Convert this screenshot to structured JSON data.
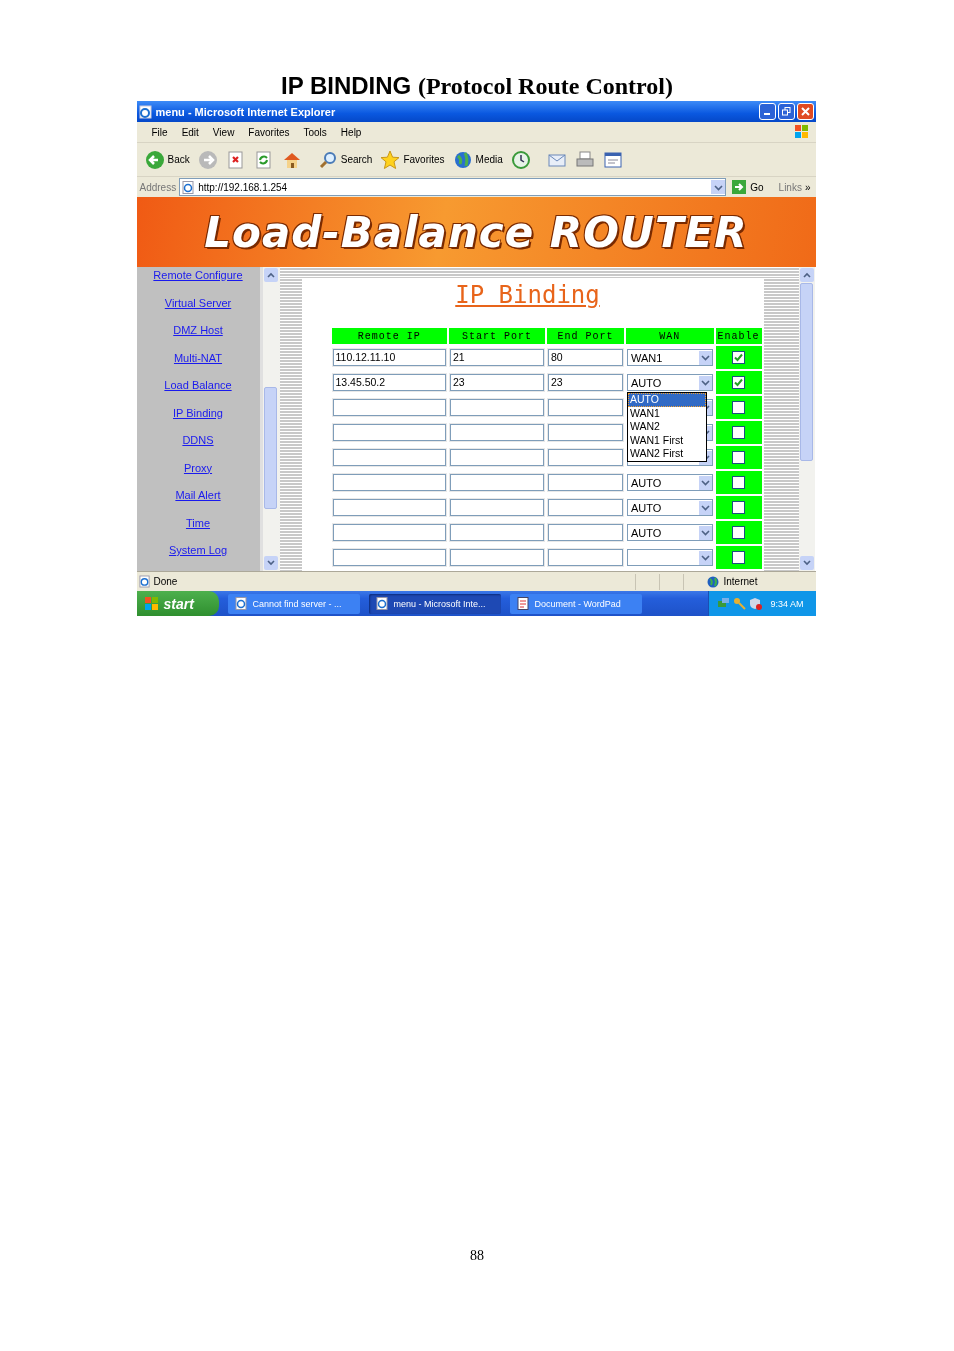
{
  "heading": {
    "title": "IP BINDING",
    "subtitle": "(Protocol Route Control)"
  },
  "window": {
    "title": "menu - Microsoft Internet Explorer"
  },
  "menu": [
    "File",
    "Edit",
    "View",
    "Favorites",
    "Tools",
    "Help"
  ],
  "toolbar": [
    {
      "kind": "back",
      "label": "Back"
    },
    {
      "kind": "forward"
    },
    {
      "kind": "stop"
    },
    {
      "kind": "refresh"
    },
    {
      "kind": "home"
    },
    {
      "kind": "search",
      "label": "Search"
    },
    {
      "kind": "favorites",
      "label": "Favorites"
    },
    {
      "kind": "media",
      "label": "Media"
    },
    {
      "kind": "history"
    },
    {
      "kind": "mail"
    },
    {
      "kind": "print"
    },
    {
      "kind": "edit"
    }
  ],
  "address": {
    "label": "Address",
    "value": "http://192.168.1.254",
    "go": "Go",
    "links": "Links",
    "more": "»"
  },
  "banner": {
    "title": "Load-Balance ROUTER"
  },
  "sidebar": {
    "items": [
      "Remote Configure",
      "Virtual Server",
      "DMZ Host",
      "Multi-NAT",
      "Load Balance",
      "IP Binding",
      "DDNS",
      "Proxy",
      "Mail Alert",
      "Time",
      "System Log"
    ]
  },
  "page": {
    "title": "IP Binding",
    "columns": [
      "Remote IP",
      "Start Port",
      "End Port",
      "WAN",
      "Enable"
    ],
    "rows": [
      {
        "remote_ip": "110.12.11.10",
        "start_port": "21",
        "end_port": "80",
        "wan": "WAN1",
        "enabled": true
      },
      {
        "remote_ip": "13.45.50.2",
        "start_port": "23",
        "end_port": "23",
        "wan": "AUTO",
        "enabled": true,
        "options": [
          {
            "label": "AUTO",
            "selected": true
          },
          {
            "label": "WAN1",
            "selected": false
          },
          {
            "label": "WAN2",
            "selected": false
          },
          {
            "label": "WAN1 First",
            "selected": false
          },
          {
            "label": "WAN2 First",
            "selected": false
          }
        ]
      },
      {
        "enabled": false
      },
      {
        "enabled": false
      },
      {
        "enabled": false
      },
      {
        "wan": "AUTO",
        "enabled": false
      },
      {
        "wan": "AUTO",
        "enabled": false
      },
      {
        "wan": "AUTO",
        "enabled": false
      },
      {
        "enabled": false
      }
    ]
  },
  "status_bar": {
    "text": "Done",
    "zone": "Internet"
  },
  "taskbar": {
    "start": "start",
    "tasks": [
      {
        "kind": "browser",
        "label": "Cannot find server - ...",
        "selected": false
      },
      {
        "kind": "browser",
        "label": "menu - Microsoft Inte...",
        "selected": true
      },
      {
        "kind": "document",
        "label": "Document - WordPad",
        "selected": false
      }
    ],
    "clock": "9:34 AM"
  },
  "page_number": "88"
}
